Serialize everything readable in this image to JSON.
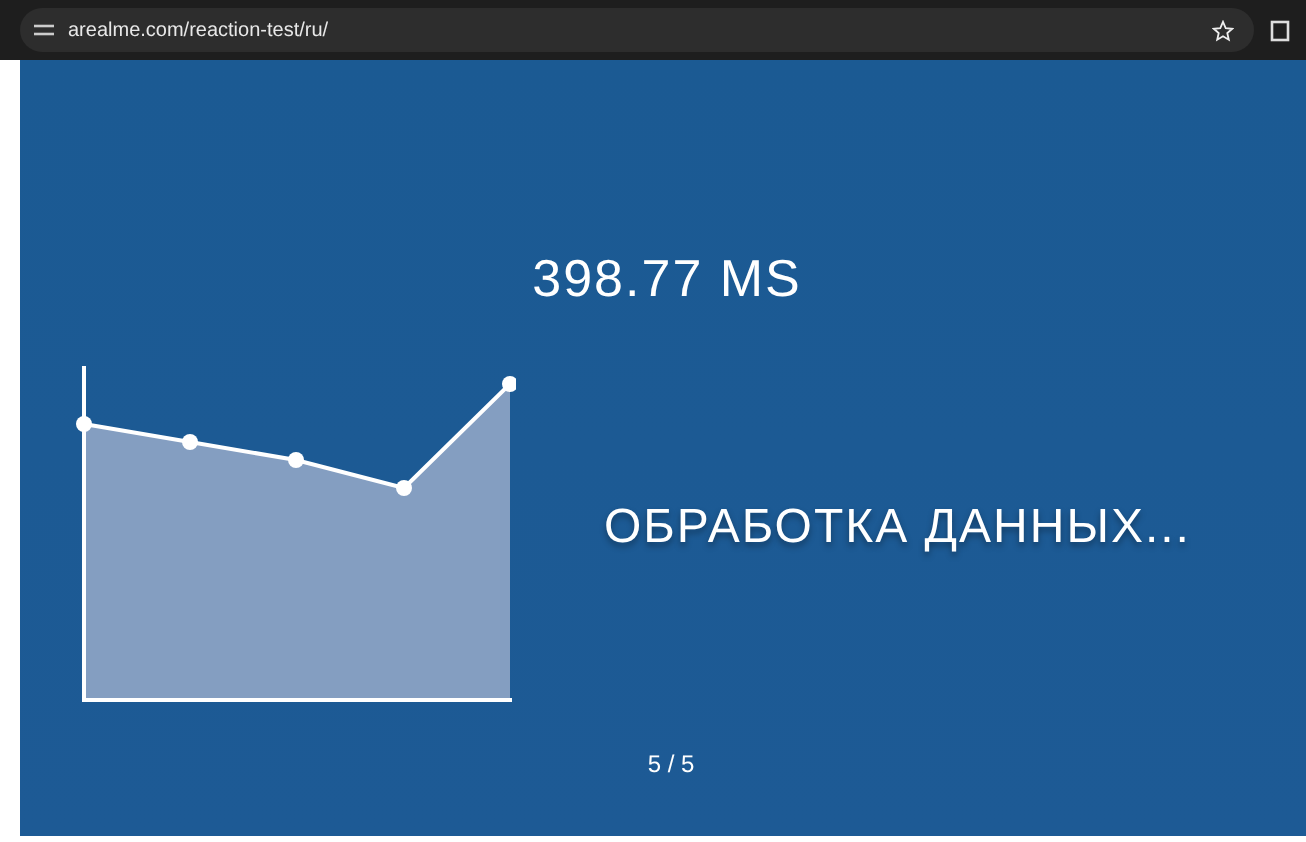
{
  "browser": {
    "url": "arealme.com/reaction-test/ru/"
  },
  "result": "398.77 MS",
  "status": "ОБРАБОТКА ДАННЫХ...",
  "progress": "5 / 5"
}
